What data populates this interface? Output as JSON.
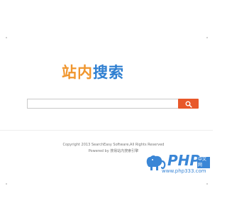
{
  "logo": {
    "part1": "站内",
    "part2": "搜索"
  },
  "search": {
    "value": "",
    "placeholder": "",
    "button_icon": "search-icon"
  },
  "footer": {
    "copyright": "Copyright 2013 SearchEasy Software,All Rights Reserved",
    "powered": "Powered by 搜易站内搜索引擎"
  },
  "watermark": {
    "brand": "PHP",
    "badge": "中文网",
    "url": "www.php333.com",
    "icon": "elephant-icon"
  },
  "colors": {
    "logo_orange": "#f0962e",
    "logo_blue": "#2f7fd1",
    "button": "#e8582a",
    "watermark_blue": "#3a86d6"
  }
}
